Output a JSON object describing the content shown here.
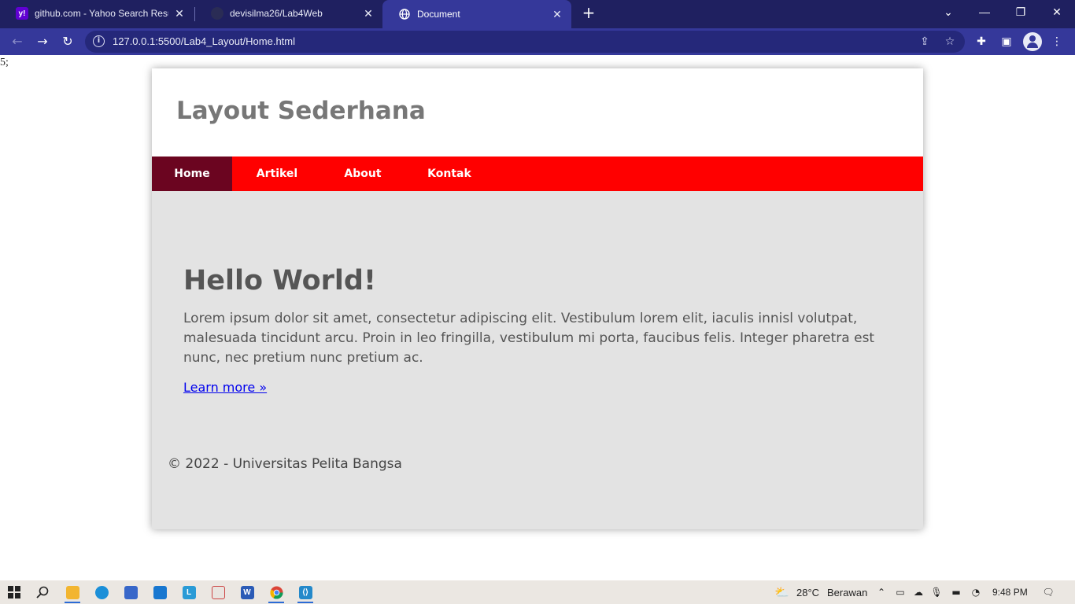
{
  "browser": {
    "tabs": [
      {
        "title": "github.com - Yahoo Search Results",
        "favicon": "y!"
      },
      {
        "title": "devisilma26/Lab4Web",
        "favicon": ""
      },
      {
        "title": "Document",
        "favicon": "globe-icon"
      }
    ],
    "url": "127.0.0.1:5500/Lab4_Layout/Home.html",
    "colors": {
      "tabbar": "#1f2060",
      "toolbar": "#35389a",
      "omnibox": "#25287a"
    }
  },
  "page": {
    "stray_text": "5;",
    "site_title": "Layout Sederhana",
    "nav": [
      {
        "label": "Home",
        "active": true
      },
      {
        "label": "Artikel",
        "active": false
      },
      {
        "label": "About",
        "active": false
      },
      {
        "label": "Kontak",
        "active": false
      }
    ],
    "hero": {
      "heading": "Hello World!",
      "body": "Lorem ipsum dolor sit amet, consectetur adipiscing elit. Vestibulum lorem elit, iaculis innisl volutpat, malesuada tincidunt arcu. Proin in leo fringilla, vestibulum mi porta, faucibus felis. Integer pharetra est nunc, nec pretium nunc pretium ac.",
      "link": "Learn more »"
    },
    "footer": "© 2022 - Universitas Pelita Bangsa",
    "colors": {
      "nav_bg": "#ff0000",
      "nav_active": "#6b0520",
      "content_bg": "#e3e3e3",
      "title": "#777777"
    }
  },
  "taskbar": {
    "weather_temp": "28°C",
    "weather_text": "Berawan",
    "time": "9:48 PM"
  }
}
